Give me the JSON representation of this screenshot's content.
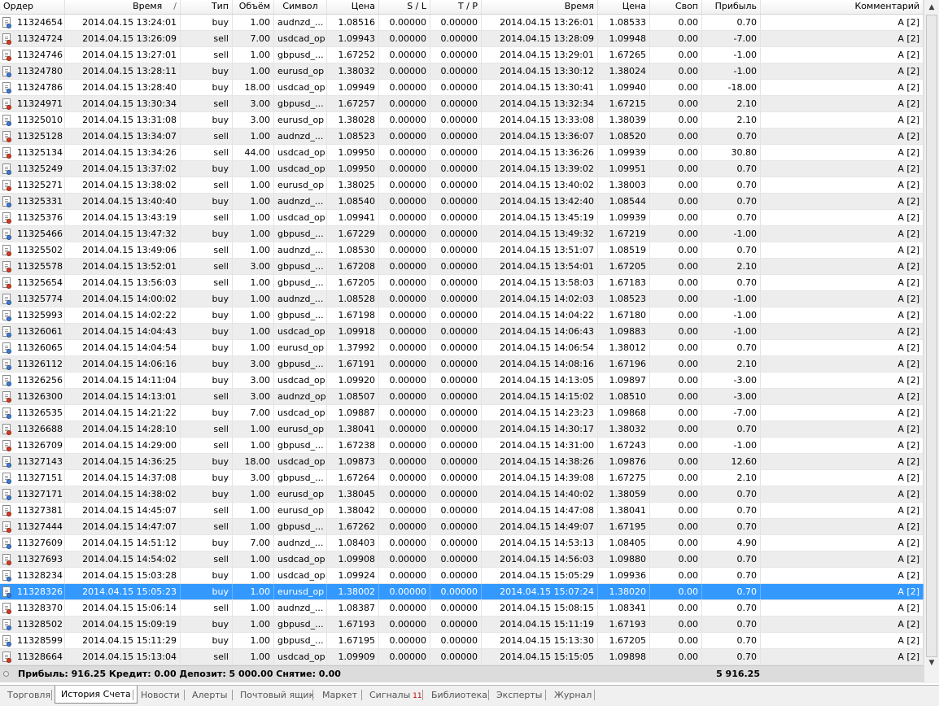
{
  "columns": [
    {
      "key": "order",
      "label": "Ордер",
      "sort_indicator": ""
    },
    {
      "key": "open_time",
      "label": "Время",
      "sort_indicator": "/"
    },
    {
      "key": "type",
      "label": "Тип",
      "sort_indicator": ""
    },
    {
      "key": "volume",
      "label": "Объём",
      "sort_indicator": ""
    },
    {
      "key": "symbol",
      "label": "Символ",
      "sort_indicator": ""
    },
    {
      "key": "open_price",
      "label": "Цена",
      "sort_indicator": ""
    },
    {
      "key": "sl",
      "label": "S / L",
      "sort_indicator": ""
    },
    {
      "key": "tp",
      "label": "T / P",
      "sort_indicator": ""
    },
    {
      "key": "close_time",
      "label": "Время",
      "sort_indicator": ""
    },
    {
      "key": "close_price",
      "label": "Цена",
      "sort_indicator": ""
    },
    {
      "key": "swap",
      "label": "Своп",
      "sort_indicator": ""
    },
    {
      "key": "profit",
      "label": "Прибыль",
      "sort_indicator": ""
    },
    {
      "key": "comment",
      "label": "Комментарий",
      "sort_indicator": ""
    }
  ],
  "type_colors": {
    "buy": "#3a7bd5",
    "sell": "#d83a1e"
  },
  "selected_order": "11328326",
  "rows": [
    [
      "11324654",
      "2014.04.15 13:24:01",
      "buy",
      "1.00",
      "audnzd_...",
      "1.08516",
      "0.00000",
      "0.00000",
      "2014.04.15 13:26:01",
      "1.08533",
      "0.00",
      "0.70",
      "A [2]"
    ],
    [
      "11324724",
      "2014.04.15 13:26:09",
      "sell",
      "7.00",
      "usdcad_op",
      "1.09943",
      "0.00000",
      "0.00000",
      "2014.04.15 13:28:09",
      "1.09948",
      "0.00",
      "-7.00",
      "A [2]"
    ],
    [
      "11324746",
      "2014.04.15 13:27:01",
      "sell",
      "1.00",
      "gbpusd_...",
      "1.67252",
      "0.00000",
      "0.00000",
      "2014.04.15 13:29:01",
      "1.67265",
      "0.00",
      "-1.00",
      "A [2]"
    ],
    [
      "11324780",
      "2014.04.15 13:28:11",
      "buy",
      "1.00",
      "eurusd_op",
      "1.38032",
      "0.00000",
      "0.00000",
      "2014.04.15 13:30:12",
      "1.38024",
      "0.00",
      "-1.00",
      "A [2]"
    ],
    [
      "11324786",
      "2014.04.15 13:28:40",
      "buy",
      "18.00",
      "usdcad_op",
      "1.09949",
      "0.00000",
      "0.00000",
      "2014.04.15 13:30:41",
      "1.09940",
      "0.00",
      "-18.00",
      "A [2]"
    ],
    [
      "11324971",
      "2014.04.15 13:30:34",
      "sell",
      "3.00",
      "gbpusd_...",
      "1.67257",
      "0.00000",
      "0.00000",
      "2014.04.15 13:32:34",
      "1.67215",
      "0.00",
      "2.10",
      "A [2]"
    ],
    [
      "11325010",
      "2014.04.15 13:31:08",
      "buy",
      "3.00",
      "eurusd_op",
      "1.38028",
      "0.00000",
      "0.00000",
      "2014.04.15 13:33:08",
      "1.38039",
      "0.00",
      "2.10",
      "A [2]"
    ],
    [
      "11325128",
      "2014.04.15 13:34:07",
      "sell",
      "1.00",
      "audnzd_...",
      "1.08523",
      "0.00000",
      "0.00000",
      "2014.04.15 13:36:07",
      "1.08520",
      "0.00",
      "0.70",
      "A [2]"
    ],
    [
      "11325134",
      "2014.04.15 13:34:26",
      "sell",
      "44.00",
      "usdcad_op",
      "1.09950",
      "0.00000",
      "0.00000",
      "2014.04.15 13:36:26",
      "1.09939",
      "0.00",
      "30.80",
      "A [2]"
    ],
    [
      "11325249",
      "2014.04.15 13:37:02",
      "buy",
      "1.00",
      "usdcad_op",
      "1.09950",
      "0.00000",
      "0.00000",
      "2014.04.15 13:39:02",
      "1.09951",
      "0.00",
      "0.70",
      "A [2]"
    ],
    [
      "11325271",
      "2014.04.15 13:38:02",
      "sell",
      "1.00",
      "eurusd_op",
      "1.38025",
      "0.00000",
      "0.00000",
      "2014.04.15 13:40:02",
      "1.38003",
      "0.00",
      "0.70",
      "A [2]"
    ],
    [
      "11325331",
      "2014.04.15 13:40:40",
      "buy",
      "1.00",
      "audnzd_...",
      "1.08540",
      "0.00000",
      "0.00000",
      "2014.04.15 13:42:40",
      "1.08544",
      "0.00",
      "0.70",
      "A [2]"
    ],
    [
      "11325376",
      "2014.04.15 13:43:19",
      "sell",
      "1.00",
      "usdcad_op",
      "1.09941",
      "0.00000",
      "0.00000",
      "2014.04.15 13:45:19",
      "1.09939",
      "0.00",
      "0.70",
      "A [2]"
    ],
    [
      "11325466",
      "2014.04.15 13:47:32",
      "buy",
      "1.00",
      "gbpusd_...",
      "1.67229",
      "0.00000",
      "0.00000",
      "2014.04.15 13:49:32",
      "1.67219",
      "0.00",
      "-1.00",
      "A [2]"
    ],
    [
      "11325502",
      "2014.04.15 13:49:06",
      "sell",
      "1.00",
      "audnzd_...",
      "1.08530",
      "0.00000",
      "0.00000",
      "2014.04.15 13:51:07",
      "1.08519",
      "0.00",
      "0.70",
      "A [2]"
    ],
    [
      "11325578",
      "2014.04.15 13:52:01",
      "sell",
      "3.00",
      "gbpusd_...",
      "1.67208",
      "0.00000",
      "0.00000",
      "2014.04.15 13:54:01",
      "1.67205",
      "0.00",
      "2.10",
      "A [2]"
    ],
    [
      "11325654",
      "2014.04.15 13:56:03",
      "sell",
      "1.00",
      "gbpusd_...",
      "1.67205",
      "0.00000",
      "0.00000",
      "2014.04.15 13:58:03",
      "1.67183",
      "0.00",
      "0.70",
      "A [2]"
    ],
    [
      "11325774",
      "2014.04.15 14:00:02",
      "buy",
      "1.00",
      "audnzd_...",
      "1.08528",
      "0.00000",
      "0.00000",
      "2014.04.15 14:02:03",
      "1.08523",
      "0.00",
      "-1.00",
      "A [2]"
    ],
    [
      "11325993",
      "2014.04.15 14:02:22",
      "buy",
      "1.00",
      "gbpusd_...",
      "1.67198",
      "0.00000",
      "0.00000",
      "2014.04.15 14:04:22",
      "1.67180",
      "0.00",
      "-1.00",
      "A [2]"
    ],
    [
      "11326061",
      "2014.04.15 14:04:43",
      "buy",
      "1.00",
      "usdcad_op",
      "1.09918",
      "0.00000",
      "0.00000",
      "2014.04.15 14:06:43",
      "1.09883",
      "0.00",
      "-1.00",
      "A [2]"
    ],
    [
      "11326065",
      "2014.04.15 14:04:54",
      "buy",
      "1.00",
      "eurusd_op",
      "1.37992",
      "0.00000",
      "0.00000",
      "2014.04.15 14:06:54",
      "1.38012",
      "0.00",
      "0.70",
      "A [2]"
    ],
    [
      "11326112",
      "2014.04.15 14:06:16",
      "buy",
      "3.00",
      "gbpusd_...",
      "1.67191",
      "0.00000",
      "0.00000",
      "2014.04.15 14:08:16",
      "1.67196",
      "0.00",
      "2.10",
      "A [2]"
    ],
    [
      "11326256",
      "2014.04.15 14:11:04",
      "buy",
      "3.00",
      "usdcad_op",
      "1.09920",
      "0.00000",
      "0.00000",
      "2014.04.15 14:13:05",
      "1.09897",
      "0.00",
      "-3.00",
      "A [2]"
    ],
    [
      "11326300",
      "2014.04.15 14:13:01",
      "sell",
      "3.00",
      "audnzd_op",
      "1.08507",
      "0.00000",
      "0.00000",
      "2014.04.15 14:15:02",
      "1.08510",
      "0.00",
      "-3.00",
      "A [2]"
    ],
    [
      "11326535",
      "2014.04.15 14:21:22",
      "buy",
      "7.00",
      "usdcad_op",
      "1.09887",
      "0.00000",
      "0.00000",
      "2014.04.15 14:23:23",
      "1.09868",
      "0.00",
      "-7.00",
      "A [2]"
    ],
    [
      "11326688",
      "2014.04.15 14:28:10",
      "sell",
      "1.00",
      "eurusd_op",
      "1.38041",
      "0.00000",
      "0.00000",
      "2014.04.15 14:30:17",
      "1.38032",
      "0.00",
      "0.70",
      "A [2]"
    ],
    [
      "11326709",
      "2014.04.15 14:29:00",
      "sell",
      "1.00",
      "gbpusd_...",
      "1.67238",
      "0.00000",
      "0.00000",
      "2014.04.15 14:31:00",
      "1.67243",
      "0.00",
      "-1.00",
      "A [2]"
    ],
    [
      "11327143",
      "2014.04.15 14:36:25",
      "buy",
      "18.00",
      "usdcad_op",
      "1.09873",
      "0.00000",
      "0.00000",
      "2014.04.15 14:38:26",
      "1.09876",
      "0.00",
      "12.60",
      "A [2]"
    ],
    [
      "11327151",
      "2014.04.15 14:37:08",
      "buy",
      "3.00",
      "gbpusd_...",
      "1.67264",
      "0.00000",
      "0.00000",
      "2014.04.15 14:39:08",
      "1.67275",
      "0.00",
      "2.10",
      "A [2]"
    ],
    [
      "11327171",
      "2014.04.15 14:38:02",
      "buy",
      "1.00",
      "eurusd_op",
      "1.38045",
      "0.00000",
      "0.00000",
      "2014.04.15 14:40:02",
      "1.38059",
      "0.00",
      "0.70",
      "A [2]"
    ],
    [
      "11327381",
      "2014.04.15 14:45:07",
      "sell",
      "1.00",
      "eurusd_op",
      "1.38042",
      "0.00000",
      "0.00000",
      "2014.04.15 14:47:08",
      "1.38041",
      "0.00",
      "0.70",
      "A [2]"
    ],
    [
      "11327444",
      "2014.04.15 14:47:07",
      "sell",
      "1.00",
      "gbpusd_...",
      "1.67262",
      "0.00000",
      "0.00000",
      "2014.04.15 14:49:07",
      "1.67195",
      "0.00",
      "0.70",
      "A [2]"
    ],
    [
      "11327609",
      "2014.04.15 14:51:12",
      "buy",
      "7.00",
      "audnzd_...",
      "1.08403",
      "0.00000",
      "0.00000",
      "2014.04.15 14:53:13",
      "1.08405",
      "0.00",
      "4.90",
      "A [2]"
    ],
    [
      "11327693",
      "2014.04.15 14:54:02",
      "sell",
      "1.00",
      "usdcad_op",
      "1.09908",
      "0.00000",
      "0.00000",
      "2014.04.15 14:56:03",
      "1.09880",
      "0.00",
      "0.70",
      "A [2]"
    ],
    [
      "11328234",
      "2014.04.15 15:03:28",
      "buy",
      "1.00",
      "usdcad_op",
      "1.09924",
      "0.00000",
      "0.00000",
      "2014.04.15 15:05:29",
      "1.09936",
      "0.00",
      "0.70",
      "A [2]"
    ],
    [
      "11328326",
      "2014.04.15 15:05:23",
      "buy",
      "1.00",
      "eurusd_op",
      "1.38002",
      "0.00000",
      "0.00000",
      "2014.04.15 15:07:24",
      "1.38020",
      "0.00",
      "0.70",
      "A [2]"
    ],
    [
      "11328370",
      "2014.04.15 15:06:14",
      "sell",
      "1.00",
      "audnzd_...",
      "1.08387",
      "0.00000",
      "0.00000",
      "2014.04.15 15:08:15",
      "1.08341",
      "0.00",
      "0.70",
      "A [2]"
    ],
    [
      "11328502",
      "2014.04.15 15:09:19",
      "buy",
      "1.00",
      "gbpusd_...",
      "1.67193",
      "0.00000",
      "0.00000",
      "2014.04.15 15:11:19",
      "1.67193",
      "0.00",
      "0.70",
      "A [2]"
    ],
    [
      "11328599",
      "2014.04.15 15:11:29",
      "buy",
      "1.00",
      "gbpusd_...",
      "1.67195",
      "0.00000",
      "0.00000",
      "2014.04.15 15:13:30",
      "1.67205",
      "0.00",
      "0.70",
      "A [2]"
    ],
    [
      "11328664",
      "2014.04.15 15:13:04",
      "sell",
      "1.00",
      "usdcad_op",
      "1.09909",
      "0.00000",
      "0.00000",
      "2014.04.15 15:15:05",
      "1.09898",
      "0.00",
      "0.70",
      "A [2]"
    ]
  ],
  "summary": {
    "text": "Прибыль: 916.25  Кредит: 0.00  Депозит: 5 000.00  Снятие: 0.00",
    "total_profit": "5 916.25"
  },
  "scrollbar": {
    "up_icon": "up-arrow-icon",
    "down_icon": "down-arrow-icon"
  },
  "tabs": [
    {
      "label": "Торговля",
      "active": false,
      "badge": ""
    },
    {
      "label": "История Счета",
      "active": true,
      "badge": ""
    },
    {
      "label": "Новости",
      "active": false,
      "badge": ""
    },
    {
      "label": "Алерты",
      "active": false,
      "badge": ""
    },
    {
      "label": "Почтовый ящик",
      "active": false,
      "badge": ""
    },
    {
      "label": "Маркет",
      "active": false,
      "badge": ""
    },
    {
      "label": "Сигналы",
      "active": false,
      "badge": "11"
    },
    {
      "label": "Библиотека",
      "active": false,
      "badge": ""
    },
    {
      "label": "Эксперты",
      "active": false,
      "badge": ""
    },
    {
      "label": "Журнал",
      "active": false,
      "badge": ""
    }
  ]
}
